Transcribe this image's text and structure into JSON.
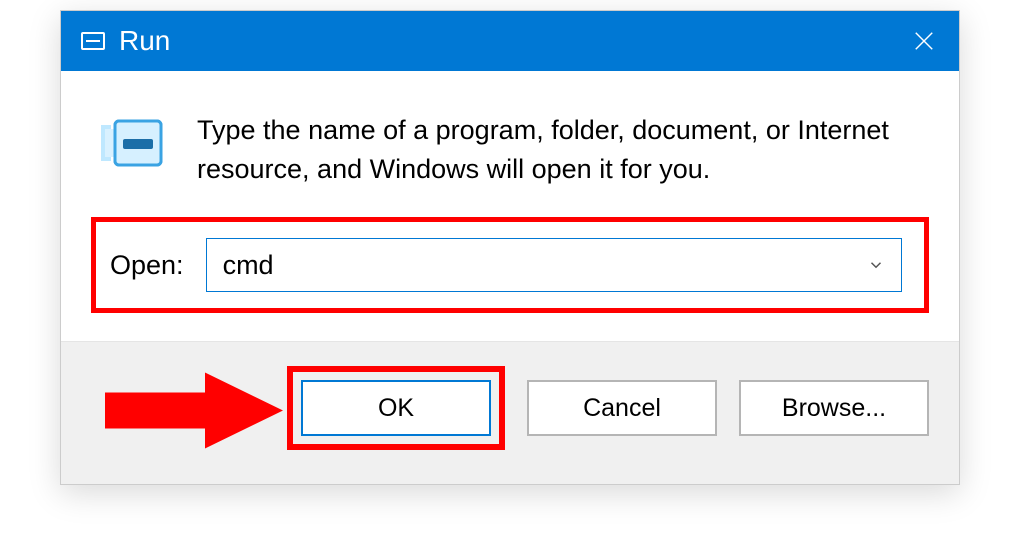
{
  "dialog": {
    "title": "Run",
    "description": "Type the name of a program, folder, document, or Internet resource, and Windows will open it for you.",
    "open_label": "Open:",
    "open_value": "cmd",
    "buttons": {
      "ok": "OK",
      "cancel": "Cancel",
      "browse": "Browse..."
    }
  }
}
